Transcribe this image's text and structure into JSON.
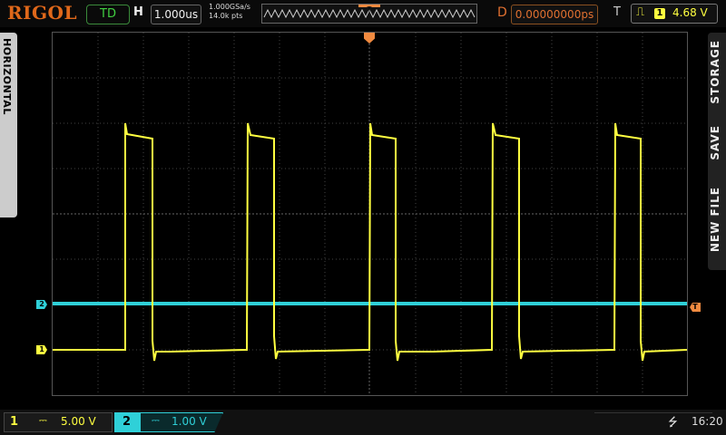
{
  "header": {
    "brand": "RIGOL",
    "run_state": "TD",
    "h_label": "H",
    "timebase": "1.000us",
    "sample_rate": "1.000GSa/s",
    "memory_depth": "14.0k pts",
    "d_label": "D",
    "delay": "0.00000000ps",
    "t_label": "T",
    "trigger_edge": "rising-edge-icon",
    "trigger_source": "1",
    "trigger_level": "4.68 V"
  },
  "side_menus": {
    "left_label": "HORIZONTAL",
    "right_labels": [
      "STORAGE",
      "SAVE",
      "NEW FILE"
    ]
  },
  "markers": {
    "ch1": "1",
    "ch2": "2",
    "trigger": "T"
  },
  "footer": {
    "ch1_number": "1",
    "ch1_coupling": "⎓",
    "ch1_scale": "5.00 V",
    "ch2_number": "2",
    "ch2_coupling": "⎓",
    "ch2_scale": "1.00 V",
    "usb_icon": "usb-icon",
    "time": "16:20"
  },
  "colors": {
    "ch1": "#ffff40",
    "ch2": "#2fd0d8",
    "trigger": "#f08a40",
    "brand": "#e0681a",
    "run_state": "#40d040"
  }
}
